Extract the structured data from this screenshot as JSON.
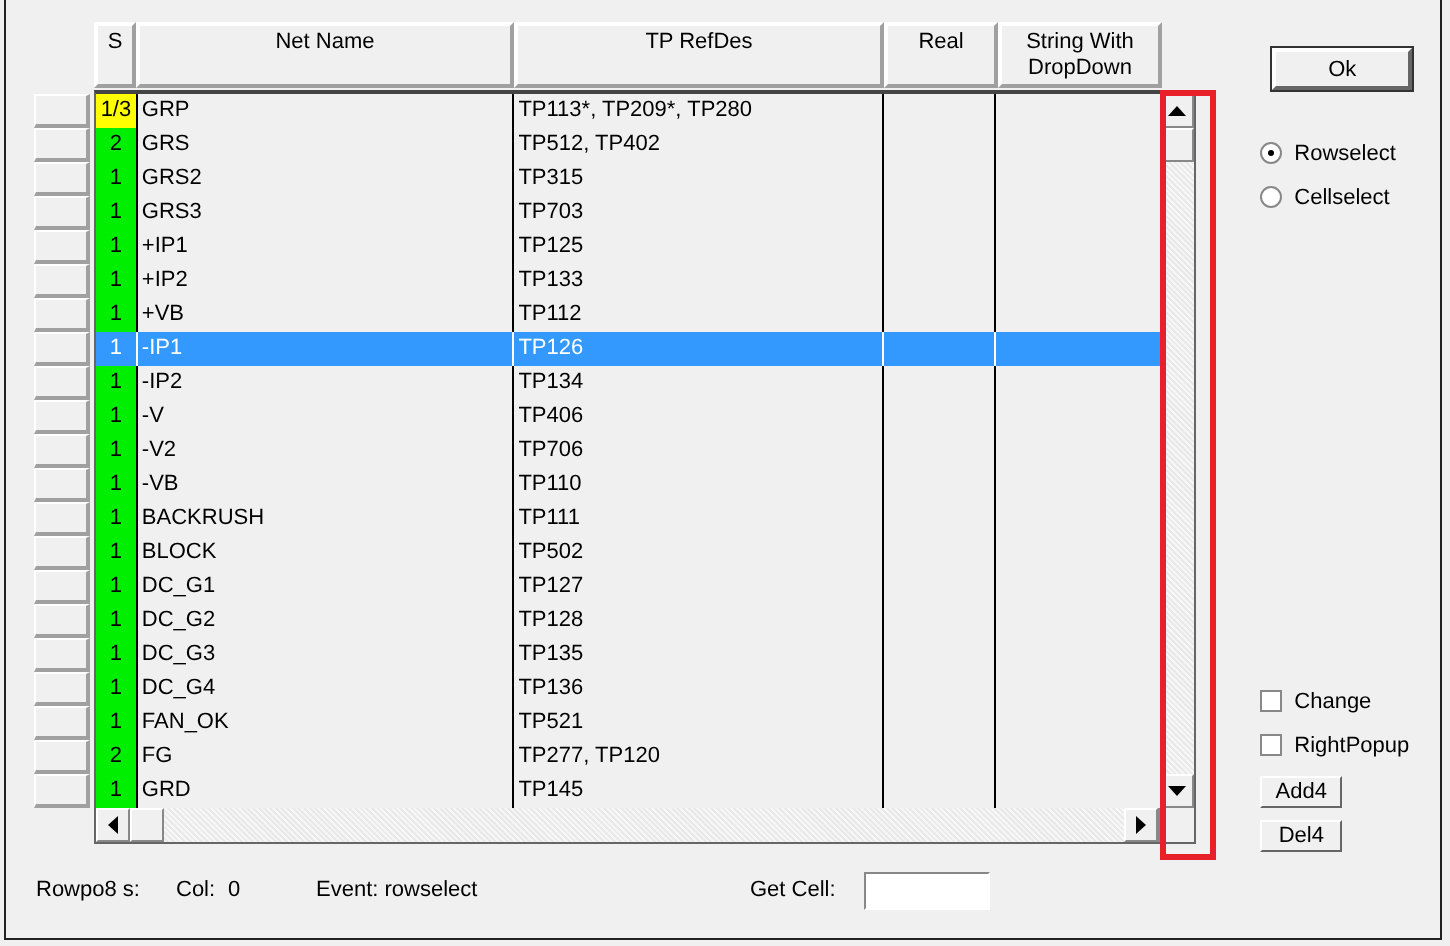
{
  "grid": {
    "columns": [
      "S",
      "Net Name",
      "TP RefDes",
      "Real",
      "String With DropDown"
    ],
    "rows": [
      {
        "s": "1/3",
        "color": "#ffff00",
        "net": "GRP",
        "tp": "TP113*, TP209*, TP280",
        "selected": false
      },
      {
        "s": "2",
        "color": "#00ee00",
        "net": "GRS",
        "tp": "TP512, TP402",
        "selected": false
      },
      {
        "s": "1",
        "color": "#00ee00",
        "net": "GRS2",
        "tp": "TP315",
        "selected": false
      },
      {
        "s": "1",
        "color": "#00ee00",
        "net": "GRS3",
        "tp": "TP703",
        "selected": false
      },
      {
        "s": "1",
        "color": "#00ee00",
        "net": "+IP1",
        "tp": "TP125",
        "selected": false
      },
      {
        "s": "1",
        "color": "#00ee00",
        "net": "+IP2",
        "tp": "TP133",
        "selected": false
      },
      {
        "s": "1",
        "color": "#00ee00",
        "net": "+VB",
        "tp": "TP112",
        "selected": false
      },
      {
        "s": "1",
        "net": "-IP1",
        "tp": "TP126",
        "selected": true
      },
      {
        "s": "1",
        "color": "#00ee00",
        "net": "-IP2",
        "tp": "TP134",
        "selected": false
      },
      {
        "s": "1",
        "color": "#00ee00",
        "net": "-V",
        "tp": "TP406",
        "selected": false
      },
      {
        "s": "1",
        "color": "#00ee00",
        "net": "-V2",
        "tp": "TP706",
        "selected": false
      },
      {
        "s": "1",
        "color": "#00ee00",
        "net": "-VB",
        "tp": "TP110",
        "selected": false
      },
      {
        "s": "1",
        "color": "#00ee00",
        "net": "BACKRUSH",
        "tp": "TP111",
        "selected": false
      },
      {
        "s": "1",
        "color": "#00ee00",
        "net": "BLOCK",
        "tp": "TP502",
        "selected": false
      },
      {
        "s": "1",
        "color": "#00ee00",
        "net": "DC_G1",
        "tp": "TP127",
        "selected": false
      },
      {
        "s": "1",
        "color": "#00ee00",
        "net": "DC_G2",
        "tp": "TP128",
        "selected": false
      },
      {
        "s": "1",
        "color": "#00ee00",
        "net": "DC_G3",
        "tp": "TP135",
        "selected": false
      },
      {
        "s": "1",
        "color": "#00ee00",
        "net": "DC_G4",
        "tp": "TP136",
        "selected": false
      },
      {
        "s": "1",
        "color": "#00ee00",
        "net": "FAN_OK",
        "tp": "TP521",
        "selected": false
      },
      {
        "s": "2",
        "color": "#00ee00",
        "net": "FG",
        "tp": "TP277, TP120",
        "selected": false
      },
      {
        "s": "1",
        "color": "#00ee00",
        "net": "GRD",
        "tp": "TP145",
        "selected": false
      }
    ]
  },
  "highlight": {
    "kind": "frame",
    "color": "#e8202a"
  },
  "ok_button": "Ok",
  "radios": [
    {
      "label": "Rowselect",
      "selected": true
    },
    {
      "label": "Cellselect",
      "selected": false
    }
  ],
  "checkboxes": [
    {
      "label": "Change",
      "checked": false
    },
    {
      "label": "RightPopup",
      "checked": false
    }
  ],
  "buttons": [
    "Add4",
    "Del4"
  ],
  "status": {
    "rowpos_label": "Rowpo8 s:",
    "col_label": "Col:",
    "col_value": "0",
    "event": "Event: rowselect",
    "get_cell_label": "Get Cell:"
  }
}
